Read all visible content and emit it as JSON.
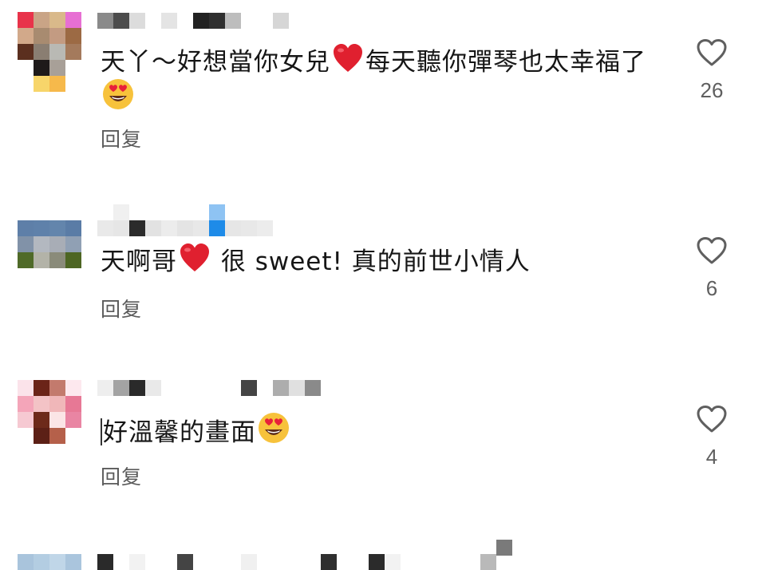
{
  "comments": [
    {
      "text_a": "天丫～好想當你女兒",
      "text_b": "每天聽你彈琴也太幸福了",
      "emoji_a": "red-heart",
      "emoji_b": "heart-eyes",
      "reply_label": "回复",
      "like_count": "26"
    },
    {
      "text_a": "天啊哥",
      "text_b": " 很 sweet! 真的前世小情人",
      "emoji_a": "red-heart",
      "reply_label": "回复",
      "like_count": "6"
    },
    {
      "text_a": "好溫馨的畫面",
      "emoji_a": "heart-eyes",
      "reply_label": "回复",
      "like_count": "4"
    }
  ],
  "colors": {
    "text": "#161616",
    "reply": "#5b5b5b",
    "heart_emoji": "#e0202f",
    "like_icon": "#5f5f5f",
    "emoji_face": "#f7c23b"
  },
  "icons": {
    "like": "heart-outline-icon",
    "avatar": "pixelated-avatar"
  }
}
